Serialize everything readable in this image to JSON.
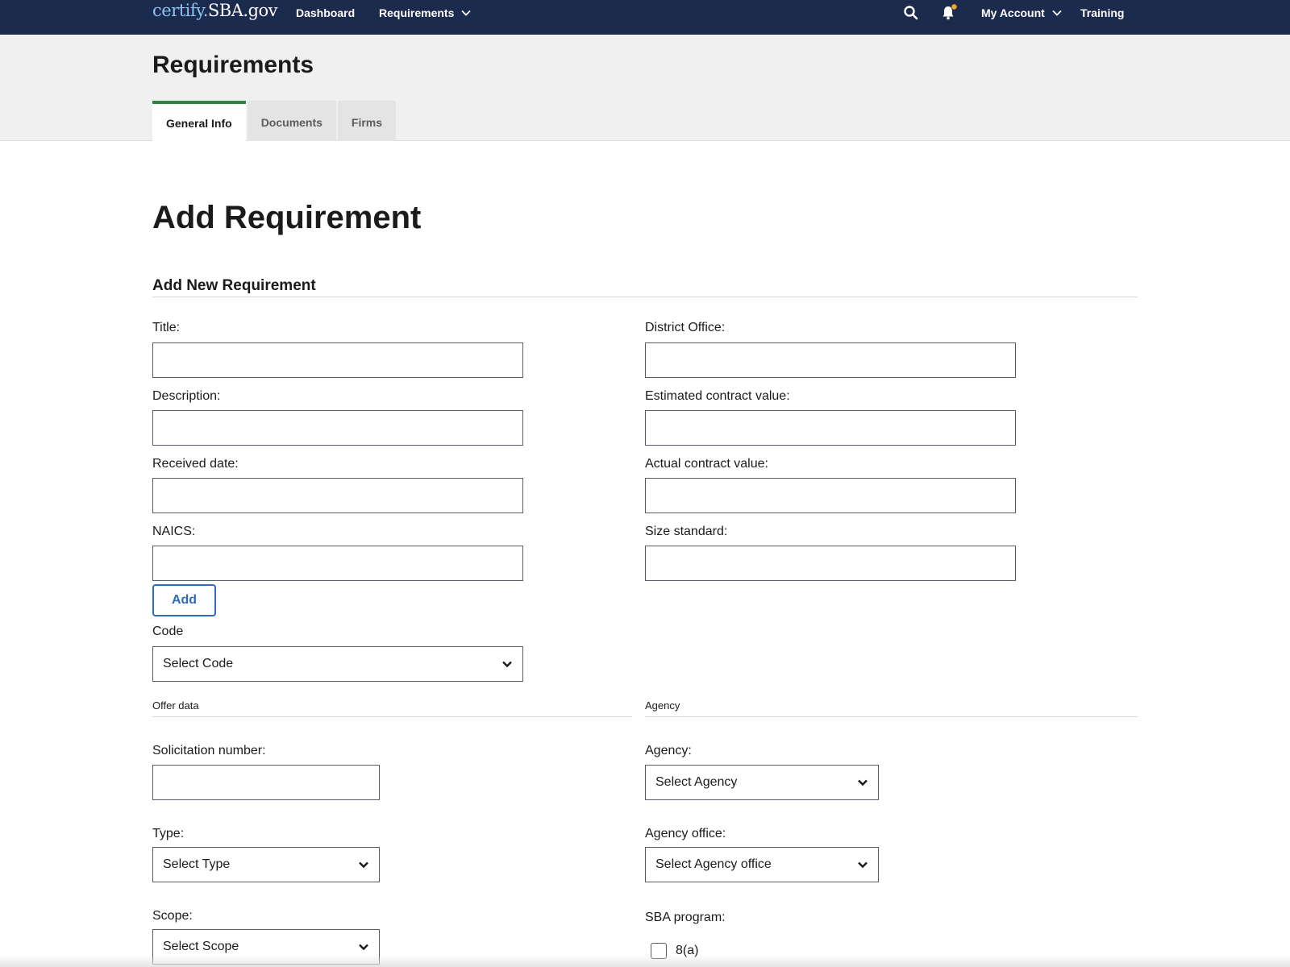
{
  "nav": {
    "brand_part1": "certify.",
    "brand_part2": "SBA.gov",
    "dashboard": "Dashboard",
    "requirements": "Requirements",
    "my_account": "My Account",
    "training": "Training",
    "notification_dot_color": "#f5a623"
  },
  "header": {
    "title": "Requirements",
    "tabs": [
      {
        "label": "General Info",
        "active": true
      },
      {
        "label": "Documents",
        "active": false
      },
      {
        "label": "Firms",
        "active": false
      }
    ]
  },
  "main": {
    "heading": "Add Requirement",
    "section_title": "Add New Requirement",
    "fields": {
      "title": {
        "label": "Title:",
        "value": ""
      },
      "description": {
        "label": "Description:",
        "value": ""
      },
      "received_date": {
        "label": "Received date:",
        "value": ""
      },
      "naics": {
        "label": "NAICS:",
        "value": ""
      },
      "district_office": {
        "label": "District Office:",
        "value": ""
      },
      "estimated_contract_value": {
        "label": "Estimated contract value:",
        "value": ""
      },
      "actual_contract_value": {
        "label": "Actual contract value:",
        "value": ""
      },
      "size_standard": {
        "label": "Size standard:",
        "value": ""
      }
    },
    "add_button": "Add",
    "code": {
      "label": "Code",
      "selected": "Select Code"
    },
    "offer_data": {
      "legend": "Offer data",
      "solicitation_number": {
        "label": "Solicitation number:",
        "value": ""
      },
      "type": {
        "label": "Type:",
        "selected": "Select Type"
      },
      "scope": {
        "label": "Scope:",
        "selected": "Select Scope"
      }
    },
    "agency": {
      "legend": "Agency",
      "agency": {
        "label": "Agency:",
        "selected": "Select Agency"
      },
      "agency_office": {
        "label": "Agency office:",
        "selected": "Select Agency office"
      },
      "sba_program": {
        "label": "SBA program:",
        "options": [
          {
            "label": "8(a)",
            "checked": false
          }
        ]
      }
    }
  },
  "colors": {
    "nav_bg": "#1b2b4e",
    "tab_accent": "#2e8540",
    "button_blue": "#2e6bbd"
  }
}
